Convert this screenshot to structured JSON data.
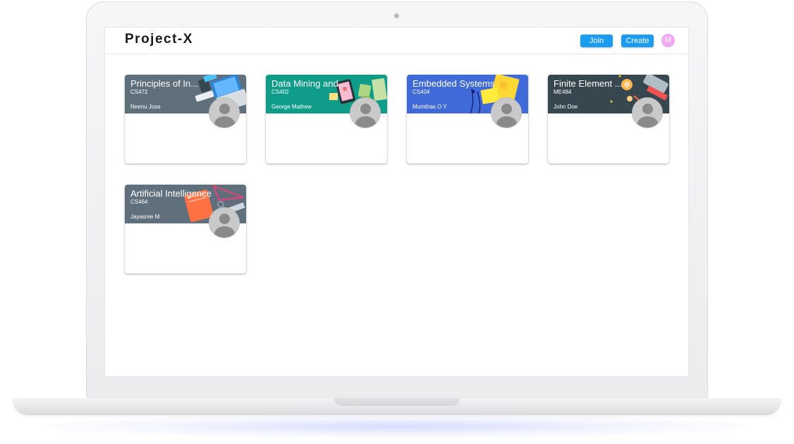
{
  "app": {
    "brand": "Project-X",
    "join_label": "Join",
    "create_label": "Create",
    "user_initial": "M"
  },
  "colors": {
    "accent": "#1a9cf0",
    "user_avatar": "#f1a7f3"
  },
  "courses": [
    {
      "title": "Principles of In...",
      "code": "CS472",
      "teacher": "Neenu Jose",
      "color": "#5f6f7c"
    },
    {
      "title": "Data Mining and...",
      "code": "CS402",
      "teacher": "George Mathew",
      "color": "#0f9d8a"
    },
    {
      "title": "Embedded Systems",
      "code": "CS404",
      "teacher": "Mumthas O Y",
      "color": "#3f6ad8"
    },
    {
      "title": "Finite Element ...",
      "code": "ME484",
      "teacher": "John Doe",
      "color": "#37474f"
    },
    {
      "title": "Artificial Intelligence",
      "code": "CS464",
      "teacher": "Jayasree M",
      "color": "#5f6f7c"
    }
  ]
}
